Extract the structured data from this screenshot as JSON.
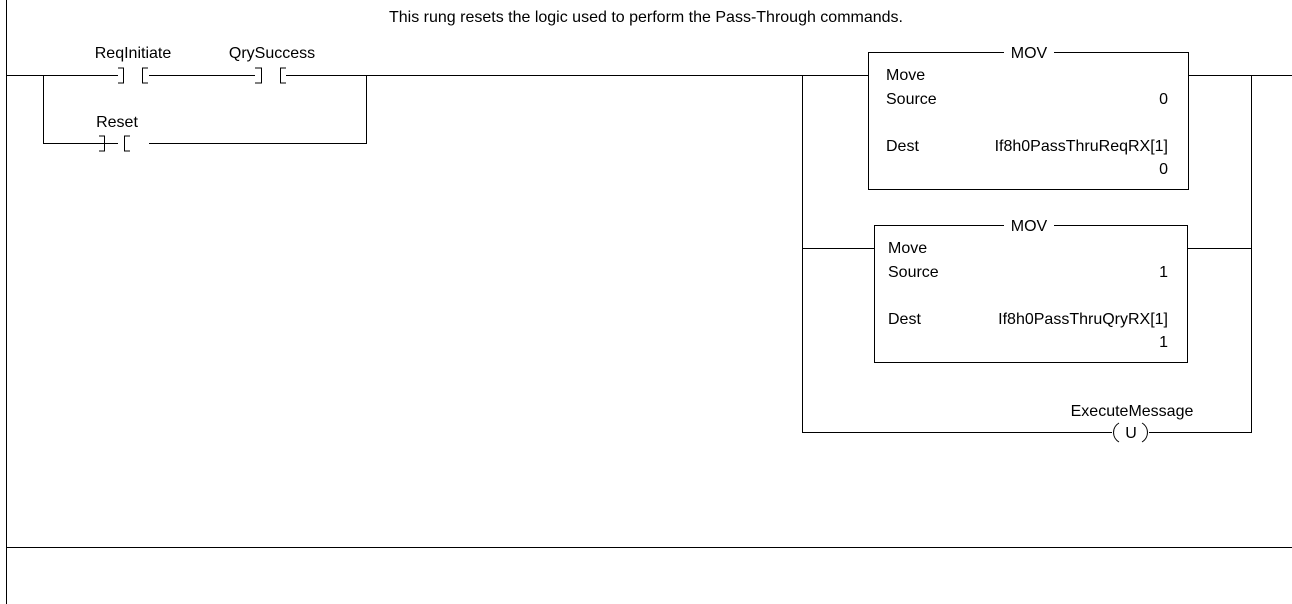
{
  "rung_comment": "This rung resets the logic used to perform the Pass-Through commands.",
  "contacts": {
    "req_initiate": "ReqInitiate",
    "qry_success": "QrySuccess",
    "reset": "Reset"
  },
  "mov1": {
    "title": "MOV",
    "name": "Move",
    "source_label": "Source",
    "source_value": "0",
    "dest_label": "Dest",
    "dest_tag": "If8h0PassThruReqRX[1]",
    "dest_value": "0"
  },
  "mov2": {
    "title": "MOV",
    "name": "Move",
    "source_label": "Source",
    "source_value": "1",
    "dest_label": "Dest",
    "dest_tag": "If8h0PassThruQryRX[1]",
    "dest_value": "1"
  },
  "unlatch": {
    "tag": "ExecuteMessage",
    "symbol": "U"
  }
}
